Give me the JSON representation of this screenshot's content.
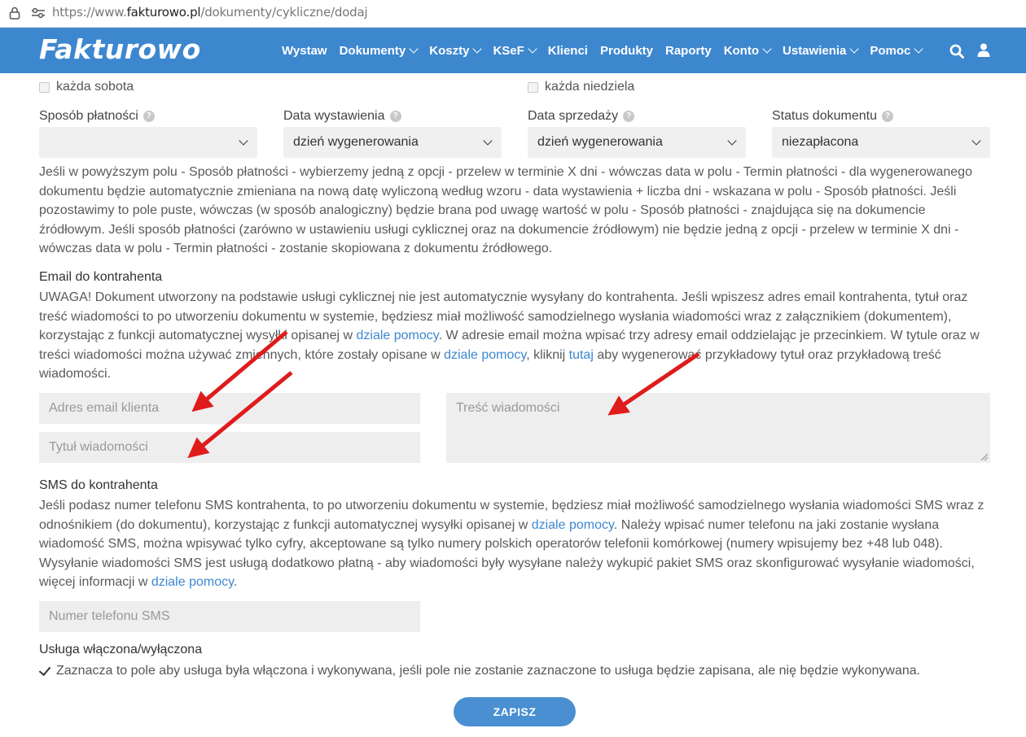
{
  "browser": {
    "url_prefix": "https://www.",
    "url_domain": "fakturowo.pl",
    "url_path": "/dokumenty/cykliczne/dodaj"
  },
  "nav": {
    "logo": "Fakturowo",
    "items": [
      {
        "label": "Wystaw",
        "dropdown": false
      },
      {
        "label": "Dokumenty",
        "dropdown": true
      },
      {
        "label": "Koszty",
        "dropdown": true
      },
      {
        "label": "KSeF",
        "dropdown": true
      },
      {
        "label": "Klienci",
        "dropdown": false
      },
      {
        "label": "Produkty",
        "dropdown": false
      },
      {
        "label": "Raporty",
        "dropdown": false
      },
      {
        "label": "Konto",
        "dropdown": true
      },
      {
        "label": "Ustawienia",
        "dropdown": true
      },
      {
        "label": "Pomoc",
        "dropdown": true
      }
    ],
    "search_icon": "search-icon",
    "user_icon": "user-icon",
    "color": "#3d87cf"
  },
  "recurrence": {
    "saturday": "każda sobota",
    "sunday": "każda niedziela"
  },
  "fields": {
    "payment_method": {
      "label": "Sposób płatności",
      "value": ""
    },
    "issue_date": {
      "label": "Data wystawienia",
      "value": "dzień wygenerowania"
    },
    "sale_date": {
      "label": "Data sprzedaży",
      "value": "dzień wygenerowania"
    },
    "doc_status": {
      "label": "Status dokumentu",
      "value": "niezapłacona"
    }
  },
  "payment_info": "Jeśli w powyższym polu - Sposób płatności - wybierzemy jedną z opcji - przelew w terminie X dni - wówczas data w polu - Termin płatności - dla wygenerowanego dokumentu będzie automatycznie zmieniana na nową datę wyliczoną według wzoru - data wystawienia + liczba dni - wskazana w polu - Sposób płatności. Jeśli pozostawimy to pole puste, wówczas (w sposób analogiczny) będzie brana pod uwagę wartość w polu - Sposób płatności - znajdująca się na dokumencie źródłowym. Jeśli sposób płatności (zarówno w ustawieniu usługi cyklicznej oraz na dokumencie źródłowym) nie będzie jedną z opcji - przelew w terminie X dni - wówczas data w polu - Termin płatności - zostanie skopiowana z dokumentu źródłowego.",
  "email": {
    "heading": "Email do kontrahenta",
    "text1": "UWAGA! Dokument utworzony na podstawie usługi cyklicznej nie jest automatycznie wysyłany do kontrahenta. Jeśli wpiszesz adres email kontrahenta, tytuł oraz treść wiadomości to po utworzeniu dokumentu w systemie, będziesz miał możliwość samodzielnego wysłania wiadomości wraz z załącznikiem (dokumentem), korzystając z funkcji automatycznej wysyłki opisanej w ",
    "link1": "dziale pomocy",
    "text2": ". W adresie email można wpisać trzy adresy email oddzielając je przecinkiem. W tytule oraz w treści wiadomości można używać zmiennych, które zostały opisane w ",
    "link2": "dziale pomocy",
    "text3": ", kliknij ",
    "link3": "tutaj",
    "text4": " aby wygenerować przykładowy tytuł oraz przykładową treść wiadomości.",
    "address_placeholder": "Adres email klienta",
    "title_placeholder": "Tytuł wiadomości",
    "body_placeholder": "Treść wiadomości"
  },
  "sms": {
    "heading": "SMS do kontrahenta",
    "text1": "Jeśli podasz numer telefonu SMS kontrahenta, to po utworzeniu dokumentu w systemie, będziesz miał możliwość samodzielnego wysłania wiadomości SMS wraz z odnośnikiem (do dokumentu), korzystając z funkcji automatycznej wysyłki opisanej w ",
    "link1": "dziale pomocy",
    "text2": ". Należy wpisać numer telefonu na jaki zostanie wysłana wiadomość SMS, można wpisywać tylko cyfry, akceptowane są tylko numery polskich operatorów telefonii komórkowej (numery wpisujemy bez +48 lub 048). Wysyłanie wiadomości SMS jest usługą dodatkowo płatną - aby wiadomości były wysyłane należy wykupić pakiet SMS oraz skonfigurować wysyłanie wiadomości, więcej informacji w ",
    "link2": "dziale pomocy",
    "text3": ".",
    "phone_placeholder": "Numer telefonu SMS"
  },
  "service": {
    "heading": "Usługa włączona/wyłączona",
    "checkbox_label": "Zaznacza to pole aby usługa była włączona i wykonywana, jeśli pole nie zostanie zaznaczone to usługa będzie zapisana, ale nię będzie wykonywana.",
    "checked": true
  },
  "save_button": "ZAPISZ",
  "annotation_color": "#e01b1b"
}
